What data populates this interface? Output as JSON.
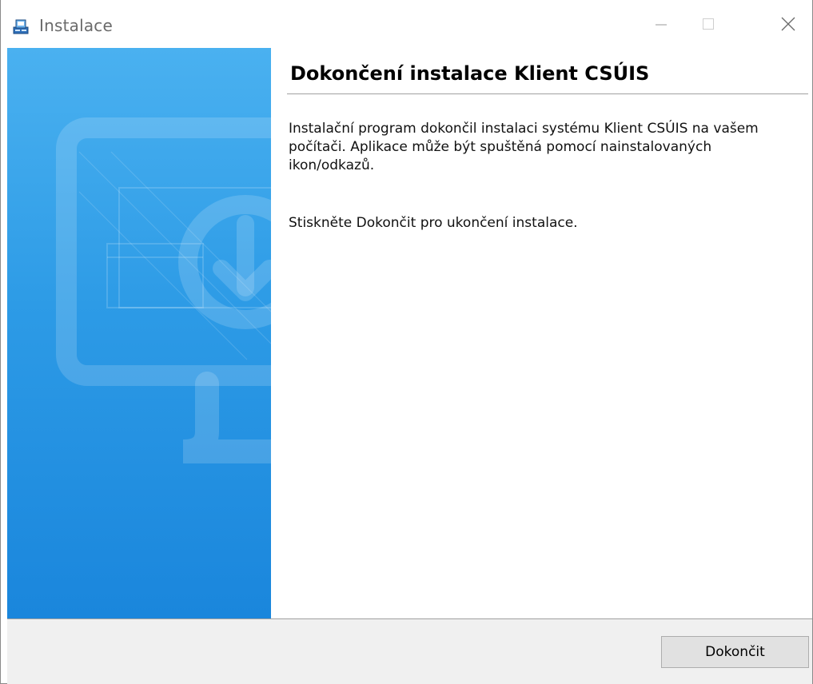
{
  "window": {
    "title": "Instalace",
    "controls": {
      "minimize": "—",
      "maximize": "□",
      "close": "✕"
    }
  },
  "wizard": {
    "heading": "Dokončení instalace Klient CSÚIS",
    "body_paragraph_1": "Instalační program dokončil instalaci systému Klient CSÚIS na vašem počítači. Aplikace může být spuštěná pomocí nainstalovaných ikon/odkazů.",
    "body_paragraph_2": "Stiskněte Dokončit pro ukončení instalace.",
    "side_image_icon": "monitor-download-icon"
  },
  "footer": {
    "finish_label": "Dokončit"
  },
  "colors": {
    "panel_top": "#4ab1f0",
    "panel_bottom": "#1a86dc",
    "footer_bg": "#f0f0f0",
    "button_bg": "#e1e1e1"
  }
}
